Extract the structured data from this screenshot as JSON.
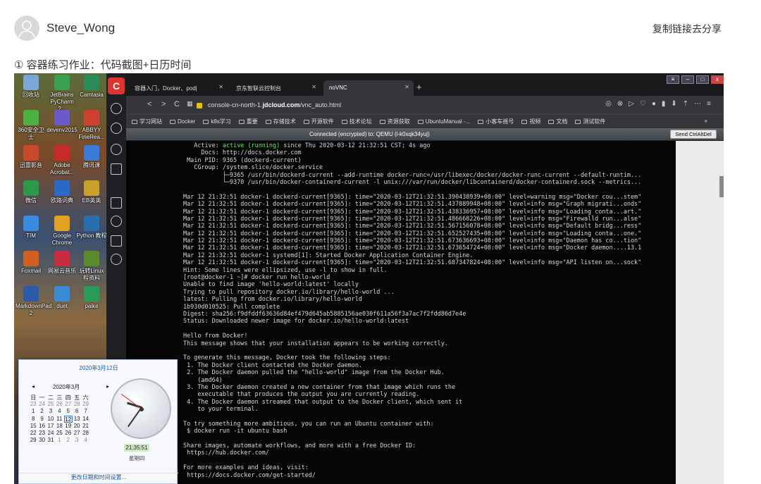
{
  "post": {
    "author": "Steve_Wong",
    "share": "复制链接去分享",
    "caption": "① 容器练习作业：代码截图+日历时间"
  },
  "desktop_icons": [
    "回收站",
    "JetBrains PyCharm 2...",
    "Camtasia",
    "360安全卫士",
    "devenv2015",
    "ABBYY FineRea...",
    "迅雷影音",
    "Adobe Acrobat...",
    "腾讯课",
    "微信",
    "欧路词典",
    "EB英英",
    "TIM",
    "Google Chrome",
    "Python 教程",
    "Foxmail",
    "网易云音乐",
    "玩转Linux 程资料",
    "MarkdownPad 2",
    "duet",
    "paike"
  ],
  "browser": {
    "tabs": [
      "容器入门，Docker、pod|",
      "京东智联云控制台",
      "noVNC"
    ],
    "url_prefix": "console-cn-north-1.",
    "url_domain": "jdcloud.com",
    "url_path": "/vnc_auto.html",
    "bookmarks": [
      "学习网站",
      "Docker",
      "k8s学习",
      "重要",
      "存储技术",
      "开源软件",
      "技术论坛",
      "资源获取",
      "UbuntuManual -...",
      "小客车摇号",
      "视频",
      "文档",
      "测试软件"
    ],
    "bookmark_more": "»"
  },
  "vnc": {
    "status": "Connected (encrypted) to: QEMU (i-k0xqk34yuj)",
    "send_button": "Send CtrlAltDel"
  },
  "terminal": {
    "active_label": "   Active: ",
    "active_value": "active (running)",
    "active_rest": " since Thu 2020-03-12 21:32:51 CST; 4s ago",
    "lines": [
      "     Docs: http://docs.docker.com",
      " Main PID: 9365 (dockerd-current)",
      "   CGroup: /system.slice/docker.service",
      "           ├─9365 /usr/bin/dockerd-current --add-runtime docker-runc=/usr/libexec/docker/docker-runc-current --default-runtim...",
      "           └─9370 /usr/bin/docker-containerd-current -l unix:///var/run/docker/libcontainerd/docker-containerd.sock --metrics...",
      "",
      "Mar 12 21:32:51 docker-1 dockerd-current[9365]: time=\"2020-03-12T21:32:51.390438939+08:00\" level=warning msg=\"Docker cou...stem\"",
      "Mar 12 21:32:51 docker-1 dockerd-current[9365]: time=\"2020-03-12T21:32:51.437889948+08:00\" level=info msg=\"Graph migrati...onds\"",
      "Mar 12 21:32:51 docker-1 dockerd-current[9365]: time=\"2020-03-12T21:32:51.438336957+08:00\" level=info msg=\"Loading conta...art.\"",
      "Mar 12 21:32:51 docker-1 dockerd-current[9365]: time=\"2020-03-12T21:32:51.486668226+08:00\" level=info msg=\"Firewalld run...alse\"",
      "Mar 12 21:32:51 docker-1 dockerd-current[9365]: time=\"2020-03-12T21:32:51.567156078+08:00\" level=info msg=\"Default bridg...ress\"",
      "Mar 12 21:32:51 docker-1 dockerd-current[9365]: time=\"2020-03-12T21:32:51.652527435+08:00\" level=info msg=\"Loading conta...one.\"",
      "Mar 12 21:32:51 docker-1 dockerd-current[9365]: time=\"2020-03-12T21:32:51.673636693+08:00\" level=info msg=\"Daemon has co...tion\"",
      "Mar 12 21:32:51 docker-1 dockerd-current[9365]: time=\"2020-03-12T21:32:51.673654724+08:00\" level=info msg=\"Docker daemon....13.1",
      "Mar 12 21:32:51 docker-1 systemd[1]: Started Docker Application Container Engine.",
      "Mar 12 21:32:51 docker-1 dockerd-current[9365]: time=\"2020-03-12T21:32:51.687347824+08:00\" level=info msg=\"API listen on...sock\"",
      "Hint: Some lines were ellipsized, use -l to show in full.",
      "[root@docker-1 ~]# docker run hello-world",
      "Unable to find image 'hello-world:latest' locally",
      "Trying to pull repository docker.io/library/hello-world ...",
      "latest: Pulling from docker.io/library/hello-world",
      "1b930d010525: Pull complete",
      "Digest: sha256:f9dfddf63636d84ef479d645ab5885156ae030f611a56f3a7ac7f2fdd86d7e4e",
      "Status: Downloaded newer image for docker.io/hello-world:latest",
      "",
      "Hello from Docker!",
      "This message shows that your installation appears to be working correctly.",
      "",
      "To generate this message, Docker took the following steps:",
      " 1. The Docker client contacted the Docker daemon.",
      " 2. The Docker daemon pulled the \"hello-world\" image from the Docker Hub.",
      "    (amd64)",
      " 3. The Docker daemon created a new container from that image which runs the",
      "    executable that produces the output you are currently reading.",
      " 4. The Docker daemon streamed that output to the Docker client, which sent it",
      "    to your terminal.",
      "",
      "To try something more ambitious, you can run an Ubuntu container with:",
      " $ docker run -it ubuntu bash",
      "",
      "Share images, automate workflows, and more with a free Docker ID:",
      " https://hub.docker.com/",
      "",
      "For more examples and ideas, visit:",
      " https://docs.docker.com/get-started/"
    ]
  },
  "calendar": {
    "header": "2020年3月12日",
    "month": "2020年3月",
    "prev": "◂",
    "next": "▸",
    "weekdays": [
      "日",
      "一",
      "二",
      "三",
      "四",
      "五",
      "六"
    ],
    "weeks": [
      [
        "23",
        "24",
        "25",
        "26",
        "27",
        "28",
        "29"
      ],
      [
        "1",
        "2",
        "3",
        "4",
        "5",
        "6",
        "7"
      ],
      [
        "8",
        "9",
        "10",
        "11",
        "12",
        "13",
        "14"
      ],
      [
        "15",
        "16",
        "17",
        "18",
        "19",
        "20",
        "21"
      ],
      [
        "22",
        "23",
        "24",
        "25",
        "26",
        "27",
        "28"
      ],
      [
        "29",
        "30",
        "31",
        "1",
        "2",
        "3",
        "4"
      ]
    ],
    "today": "12",
    "time": "21:35:51",
    "weekday": "星期四",
    "link": "更改日期和时间设置...",
    "clock": {
      "hour": 21,
      "minute": 35,
      "second": 51
    }
  },
  "colors": {
    "accent": "#1a5aa8",
    "terminal_green": "#7de07d",
    "logo_red": "#e0332e"
  }
}
